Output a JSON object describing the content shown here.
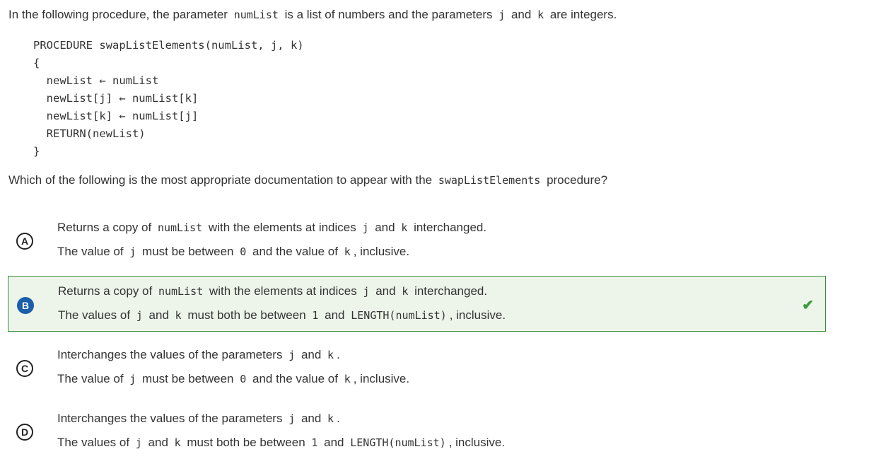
{
  "intro": [
    {
      "t": "In the following procedure, the parameter "
    },
    {
      "t": "numList",
      "code": true
    },
    {
      "t": " is a list of numbers and the parameters "
    },
    {
      "t": "j",
      "code": true
    },
    {
      "t": " and "
    },
    {
      "t": "k",
      "code": true
    },
    {
      "t": " are integers."
    }
  ],
  "code_lines": [
    "PROCEDURE swapListElements(numList, j, k)",
    "{",
    "  newList ← numList",
    "  newList[j] ← numList[k]",
    "  newList[k] ← numList[j]",
    "  RETURN(newList)",
    "}"
  ],
  "question": [
    {
      "t": "Which of the following is the most appropriate documentation to appear with the "
    },
    {
      "t": "swapListElements",
      "code": true
    },
    {
      "t": " procedure?"
    }
  ],
  "options": [
    {
      "letter": "A",
      "correct": false,
      "lines": [
        [
          {
            "t": "Returns a copy of "
          },
          {
            "t": "numList",
            "code": true
          },
          {
            "t": " with the elements at indices "
          },
          {
            "t": "j",
            "code": true
          },
          {
            "t": " and "
          },
          {
            "t": "k",
            "code": true
          },
          {
            "t": " interchanged."
          }
        ],
        [
          {
            "t": "The value of "
          },
          {
            "t": "j",
            "code": true
          },
          {
            "t": " must be between "
          },
          {
            "t": "0",
            "code": true
          },
          {
            "t": " and the value of "
          },
          {
            "t": "k",
            "code": true
          },
          {
            "t": ", inclusive."
          }
        ]
      ]
    },
    {
      "letter": "B",
      "correct": true,
      "lines": [
        [
          {
            "t": "Returns a copy of "
          },
          {
            "t": "numList",
            "code": true
          },
          {
            "t": " with the elements at indices "
          },
          {
            "t": "j",
            "code": true
          },
          {
            "t": " and "
          },
          {
            "t": "k",
            "code": true
          },
          {
            "t": " interchanged."
          }
        ],
        [
          {
            "t": "The values of "
          },
          {
            "t": "j",
            "code": true
          },
          {
            "t": " and "
          },
          {
            "t": "k",
            "code": true
          },
          {
            "t": " must both be between "
          },
          {
            "t": "1",
            "code": true
          },
          {
            "t": " and "
          },
          {
            "t": "LENGTH(numList)",
            "code": true
          },
          {
            "t": ", inclusive."
          }
        ]
      ]
    },
    {
      "letter": "C",
      "correct": false,
      "lines": [
        [
          {
            "t": "Interchanges the values of the parameters "
          },
          {
            "t": "j",
            "code": true
          },
          {
            "t": " and "
          },
          {
            "t": "k",
            "code": true
          },
          {
            "t": "."
          }
        ],
        [
          {
            "t": "The value of "
          },
          {
            "t": "j",
            "code": true
          },
          {
            "t": " must be between "
          },
          {
            "t": "0",
            "code": true
          },
          {
            "t": " and the value of "
          },
          {
            "t": "k",
            "code": true
          },
          {
            "t": ", inclusive."
          }
        ]
      ]
    },
    {
      "letter": "D",
      "correct": false,
      "lines": [
        [
          {
            "t": "Interchanges the values of the parameters "
          },
          {
            "t": "j",
            "code": true
          },
          {
            "t": " and "
          },
          {
            "t": "k",
            "code": true
          },
          {
            "t": "."
          }
        ],
        [
          {
            "t": "The values of "
          },
          {
            "t": "j",
            "code": true
          },
          {
            "t": " and "
          },
          {
            "t": "k",
            "code": true
          },
          {
            "t": " must both be between "
          },
          {
            "t": "1",
            "code": true
          },
          {
            "t": " and "
          },
          {
            "t": "LENGTH(numList)",
            "code": true
          },
          {
            "t": ", inclusive."
          }
        ]
      ]
    }
  ],
  "colors": {
    "correct_bg": "#edf5ea",
    "correct_border": "#3a8a3a",
    "selected_badge": "#1b5faa",
    "check": "#3c9a3c"
  },
  "icons": {
    "correct": "check-icon"
  }
}
